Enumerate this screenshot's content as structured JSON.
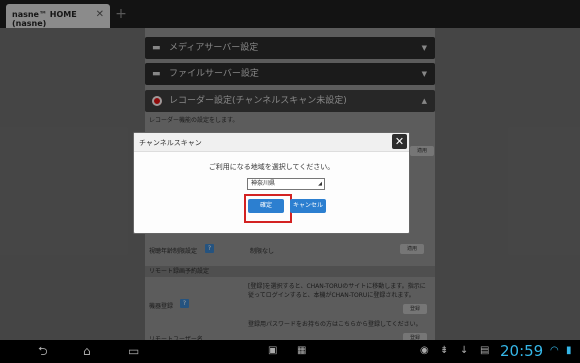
{
  "tab": {
    "title": "nasne™ HOME (nasne)",
    "close": "✕",
    "new": "+"
  },
  "sections": [
    {
      "label": "メディアサーバー設定",
      "arrow": "▼",
      "icon": "server-icon"
    },
    {
      "label": "ファイルサーバー設定",
      "arrow": "▼",
      "icon": "file-server-icon"
    },
    {
      "label": "レコーダー設定(チャンネルスキャン未設定)",
      "arrow": "▲",
      "icon": "record-icon"
    }
  ],
  "recorder": {
    "description": "レコーダー機能の設定をします。",
    "age_limit_label": "視聴年齢制限設定",
    "age_limit_value": "制限なし",
    "age_limit_button": "適用",
    "remote_section": "リモート録画予約設定",
    "device_reg_label": "機器登録",
    "device_reg_text": "[登録]を選択すると、CHAN-TORUのサイトに移動します。指示に従ってログインすると、本機がCHAN-TORUに登録されます。",
    "device_reg_button": "登録",
    "password_text": "登録用パスワードをお持ちの方はこちらから登録してください。",
    "password_button": "登録",
    "remote_user_label": "リモートユーザー名",
    "help": "?",
    "side_button": "適用"
  },
  "dialog": {
    "title": "チャンネルスキャン",
    "message": "ご利用になる地域を選択してください。",
    "selected_region": "神奈川県",
    "ok_label": "確定",
    "cancel_label": "キャンセル",
    "close": "✕"
  },
  "statusbar": {
    "clock": "20:59"
  }
}
